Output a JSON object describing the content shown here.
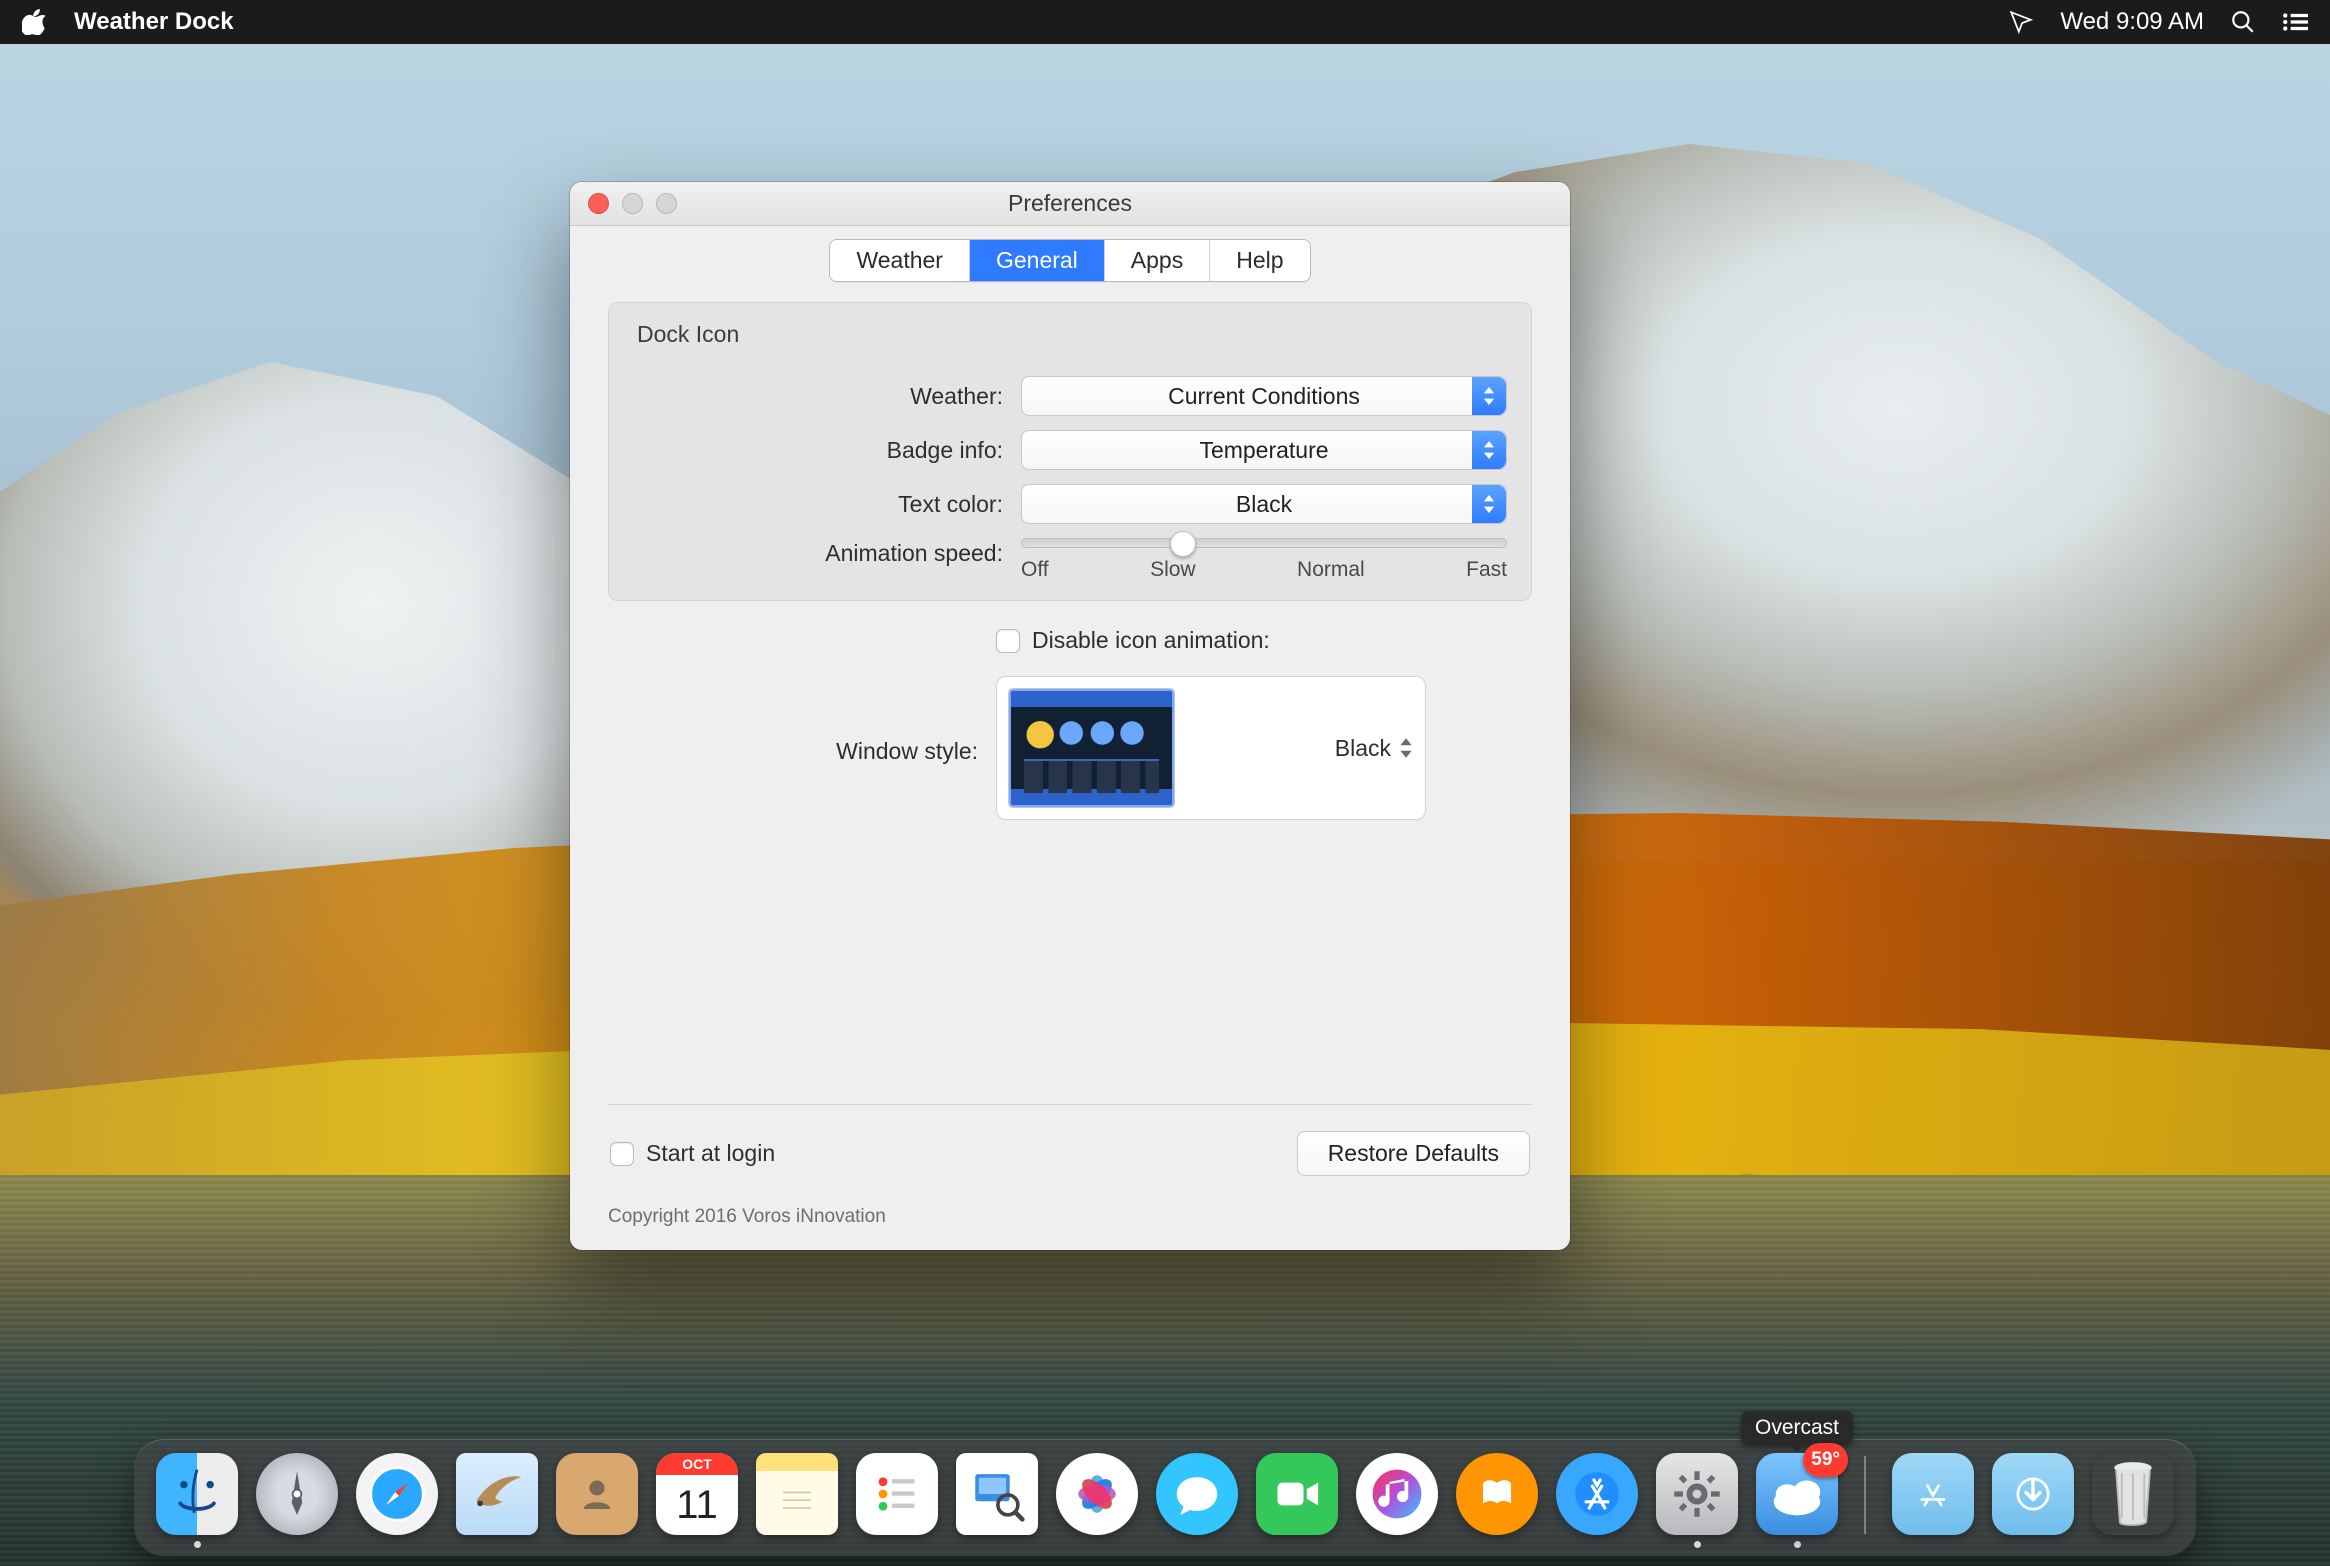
{
  "menubar": {
    "app_name": "Weather Dock",
    "clock": "Wed 9:09 AM"
  },
  "pref_window": {
    "title": "Preferences",
    "tabs": [
      "Weather",
      "General",
      "Apps",
      "Help"
    ],
    "active_tab_index": 1,
    "group_title": "Dock Icon",
    "weather": {
      "label": "Weather:",
      "value": "Current Conditions"
    },
    "badge": {
      "label": "Badge info:",
      "value": "Temperature"
    },
    "textcolor": {
      "label": "Text color:",
      "value": "Black"
    },
    "anim_speed": {
      "label": "Animation speed:",
      "ticks": [
        "Off",
        "Slow",
        "Normal",
        "Fast"
      ],
      "value_index": 1
    },
    "disable_anim": {
      "label": "Disable icon animation:",
      "checked": false
    },
    "window_style": {
      "label": "Window style:",
      "value": "Black"
    },
    "start_login": {
      "label": "Start at login",
      "checked": false
    },
    "restore_btn": "Restore Defaults",
    "copyright": "Copyright 2016 Voros iNnovation"
  },
  "dock": {
    "items": [
      {
        "name": "finder",
        "label": "Finder",
        "running": true
      },
      {
        "name": "launchpad",
        "label": "Launchpad",
        "running": false
      },
      {
        "name": "safari",
        "label": "Safari",
        "running": false
      },
      {
        "name": "mail",
        "label": "Mail",
        "running": false
      },
      {
        "name": "contacts",
        "label": "Contacts",
        "running": false
      },
      {
        "name": "calendar",
        "label": "Calendar",
        "running": false,
        "month": "OCT",
        "day": "11"
      },
      {
        "name": "notes",
        "label": "Notes",
        "running": false
      },
      {
        "name": "reminders",
        "label": "Reminders",
        "running": false
      },
      {
        "name": "preview",
        "label": "Preview",
        "running": false
      },
      {
        "name": "photos",
        "label": "Photos",
        "running": false
      },
      {
        "name": "messages",
        "label": "Messages",
        "running": false
      },
      {
        "name": "facetime",
        "label": "FaceTime",
        "running": false
      },
      {
        "name": "itunes",
        "label": "iTunes",
        "running": false
      },
      {
        "name": "ibooks",
        "label": "iBooks",
        "running": false
      },
      {
        "name": "appstore",
        "label": "App Store",
        "running": false
      },
      {
        "name": "sysprefs",
        "label": "System Preferences",
        "running": true
      },
      {
        "name": "weatherdock",
        "label": "Overcast",
        "running": true,
        "badge": "59°",
        "show_label": true
      }
    ],
    "right_items": [
      {
        "name": "folder-apps",
        "label": "Applications"
      },
      {
        "name": "folder-downloads",
        "label": "Downloads"
      },
      {
        "name": "trash",
        "label": "Trash"
      }
    ]
  }
}
